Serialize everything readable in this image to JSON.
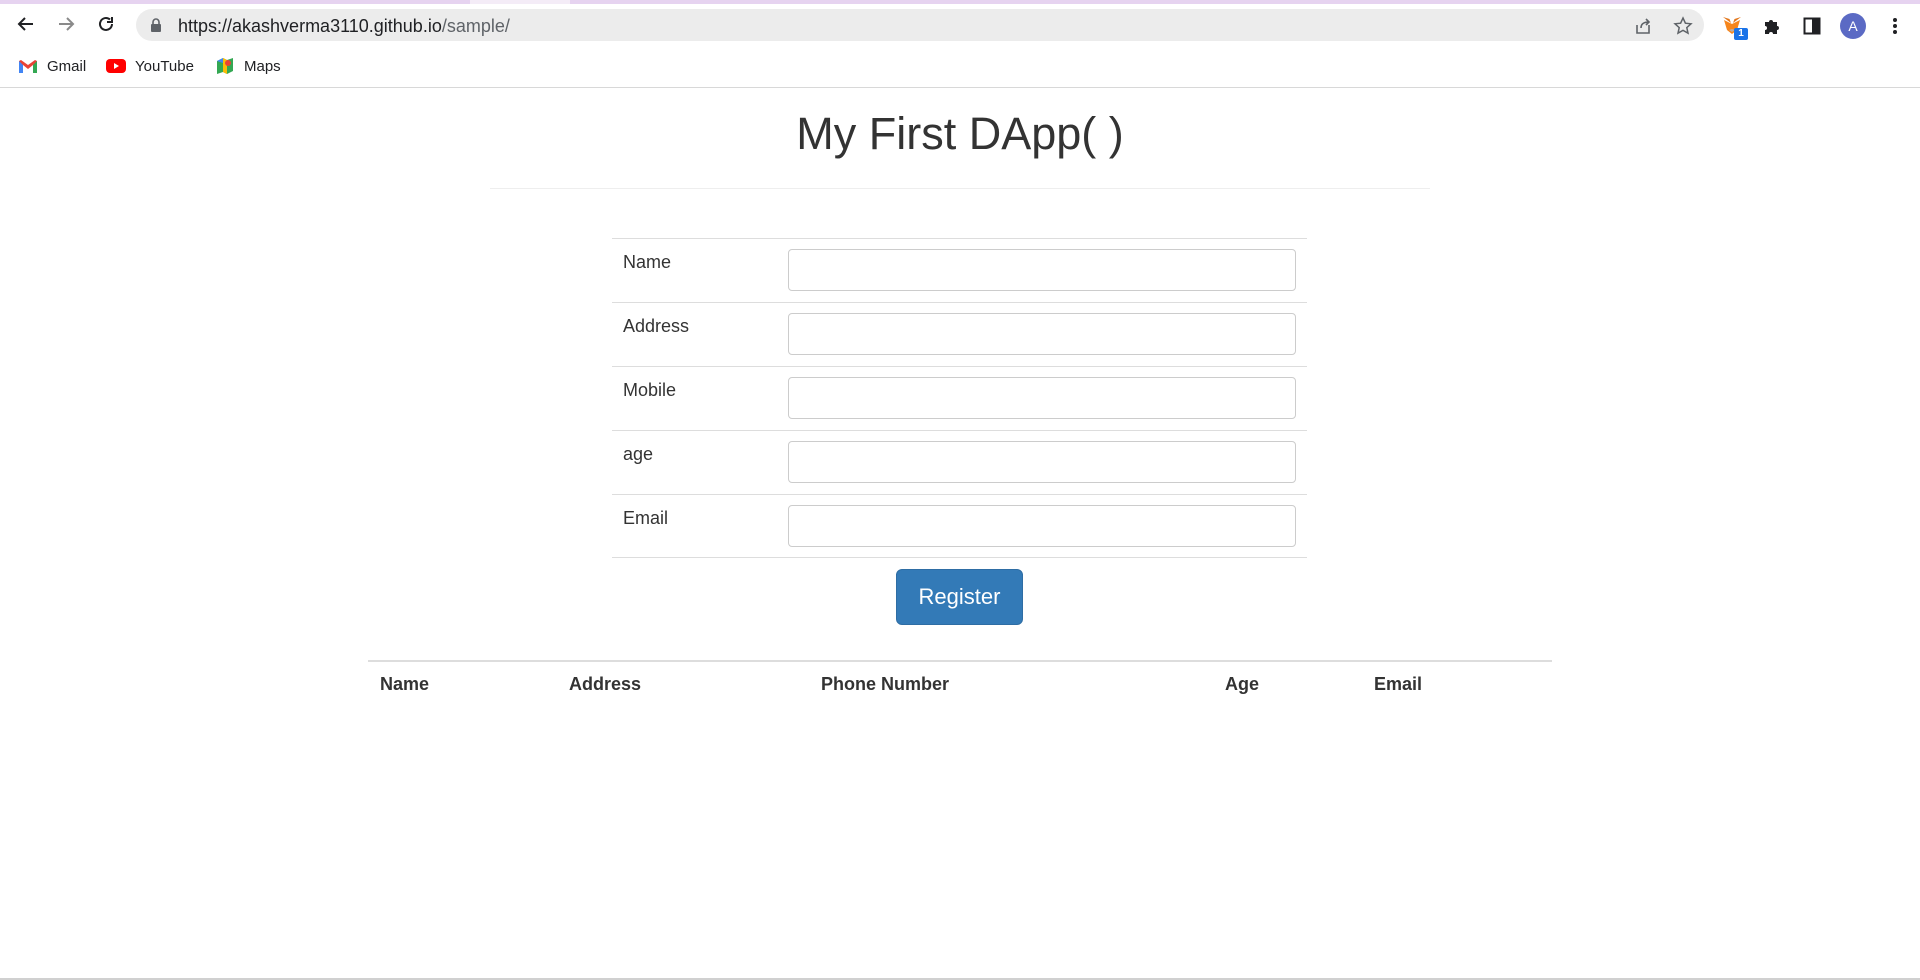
{
  "browser": {
    "url_host": "https://akashverma3110.github.io",
    "url_path": "/sample/",
    "extension_badge": "1",
    "profile_initial": "A",
    "icons": {
      "back": "back-arrow-icon",
      "forward": "forward-arrow-icon",
      "reload": "reload-icon",
      "lock": "lock-icon",
      "share": "share-icon",
      "star": "star-icon",
      "metamask": "fox-icon",
      "extensions": "puzzle-icon",
      "side_panel": "side-panel-icon",
      "menu": "kebab-menu-icon"
    },
    "bookmarks": [
      {
        "label": "Gmail",
        "icon": "gmail-icon"
      },
      {
        "label": "YouTube",
        "icon": "youtube-icon"
      },
      {
        "label": "Maps",
        "icon": "maps-icon"
      }
    ]
  },
  "page": {
    "title": "My First DApp( )",
    "form": {
      "fields": [
        {
          "label": "Name",
          "value": ""
        },
        {
          "label": "Address",
          "value": ""
        },
        {
          "label": "Mobile",
          "value": ""
        },
        {
          "label": "age",
          "value": ""
        },
        {
          "label": "Email",
          "value": ""
        }
      ],
      "submit_label": "Register"
    },
    "table": {
      "headers": [
        "Name",
        "Address",
        "Phone Number",
        "Age",
        "Email"
      ],
      "rows": []
    }
  },
  "colors": {
    "primary_button": "#337ab7",
    "text": "#333333"
  }
}
